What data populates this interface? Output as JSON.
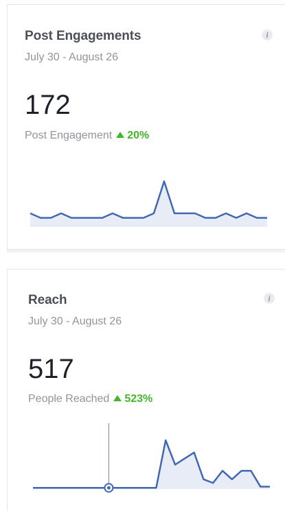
{
  "cards": [
    {
      "title": "Post Engagements",
      "date_range": "July 30 - August 26",
      "value": "172",
      "metric_label": "Post Engagement",
      "change": "20%",
      "trend": "up",
      "info_icon": "i"
    },
    {
      "title": "Reach",
      "date_range": "July 30 - August 26",
      "value": "517",
      "metric_label": "People Reached",
      "change": "523%",
      "trend": "up",
      "info_icon": "i"
    }
  ],
  "colors": {
    "line": "#4267b2",
    "fill": "#e8ecf7",
    "positive": "#42b72a"
  },
  "chart_data": [
    {
      "type": "area",
      "series": [
        {
          "values": [
            3,
            2,
            2,
            3,
            2,
            2,
            2,
            2,
            3,
            2,
            2,
            2,
            3,
            10,
            3,
            3,
            3,
            2,
            2,
            3,
            2,
            3,
            2,
            2
          ]
        }
      ],
      "ylim": [
        0,
        12
      ]
    },
    {
      "type": "area",
      "series": [
        {
          "values": [
            1,
            1,
            1,
            1,
            1,
            1,
            1,
            1,
            1,
            1,
            1,
            1,
            1,
            1,
            40,
            20,
            25,
            30,
            8,
            5,
            15,
            8,
            15,
            15,
            2,
            2
          ]
        }
      ],
      "highlight_index": 8,
      "ylim": [
        0,
        45
      ]
    }
  ]
}
